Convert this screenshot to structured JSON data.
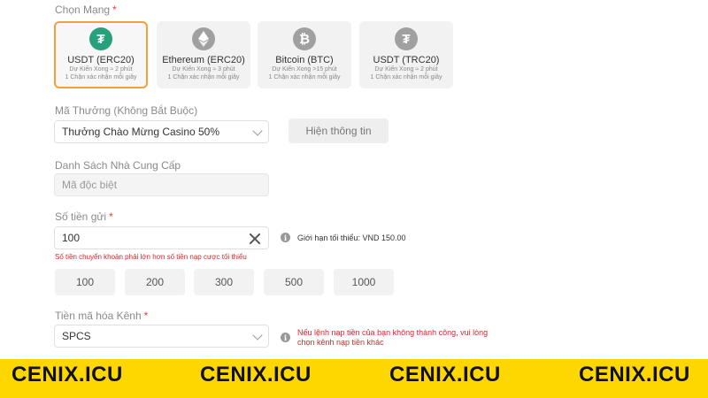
{
  "network": {
    "label": "Chọn Mạng",
    "required": "*",
    "options": [
      {
        "name": "USDT (ERC20)",
        "eta": "Dự Kiến Xong ≈ 2 phút",
        "confirm": "1 Chặn xác nhận mỗi giây",
        "icon": "tether-icon",
        "glyph": "₮",
        "color": "#26a17b",
        "selected": true
      },
      {
        "name": "Ethereum (ERC20)",
        "eta": "Dự Kiến Xong ≈ 3 phút",
        "confirm": "1 Chặn xác nhận mỗi giây",
        "icon": "ethereum-icon",
        "glyph": "◆",
        "color": "#a0a0a0",
        "selected": false
      },
      {
        "name": "Bitcoin (BTC)",
        "eta": "Dự Kiến Xong >15 phút",
        "confirm": "1 Chặn xác nhận mỗi giây",
        "icon": "bitcoin-icon",
        "glyph": "₿",
        "color": "#a0a0a0",
        "selected": false
      },
      {
        "name": "USDT (TRC20)",
        "eta": "Dự Kiến Xong ≈ 2 phút",
        "confirm": "1 Chặn xác nhận mỗi giây",
        "icon": "tether-icon",
        "glyph": "₮",
        "color": "#a0a0a0",
        "selected": false
      }
    ]
  },
  "bonus": {
    "label": "Mã Thưởng (Không Bắt Buộc)",
    "value": "Thưởng Chào Mừng Casino 50%",
    "show_info_label": "Hiện thông tin"
  },
  "provider": {
    "label": "Danh Sách Nhà Cung Cấp",
    "placeholder": "Mã độc biệt"
  },
  "deposit": {
    "label": "Số tiền gửi",
    "required": "*",
    "value": "100",
    "limit_note": "Giới hạn tối thiểu: VND 150.00",
    "error": "Số tiền chuyển khoản phải lớn hơn số tiền nạp cược tối thiểu",
    "quick_amounts": [
      "100",
      "200",
      "300",
      "500",
      "1000"
    ]
  },
  "channel": {
    "label": "Tiền mã hóa Kênh",
    "required": "*",
    "value": "SPCS",
    "note_line1": "Nếu lệnh nạp tiền của bạn không thành công, vui lòng",
    "note_line2": "chọn kênh nạp tiền khác"
  },
  "watermark": {
    "text": "CENIX.ICU",
    "color": "#fed700"
  }
}
